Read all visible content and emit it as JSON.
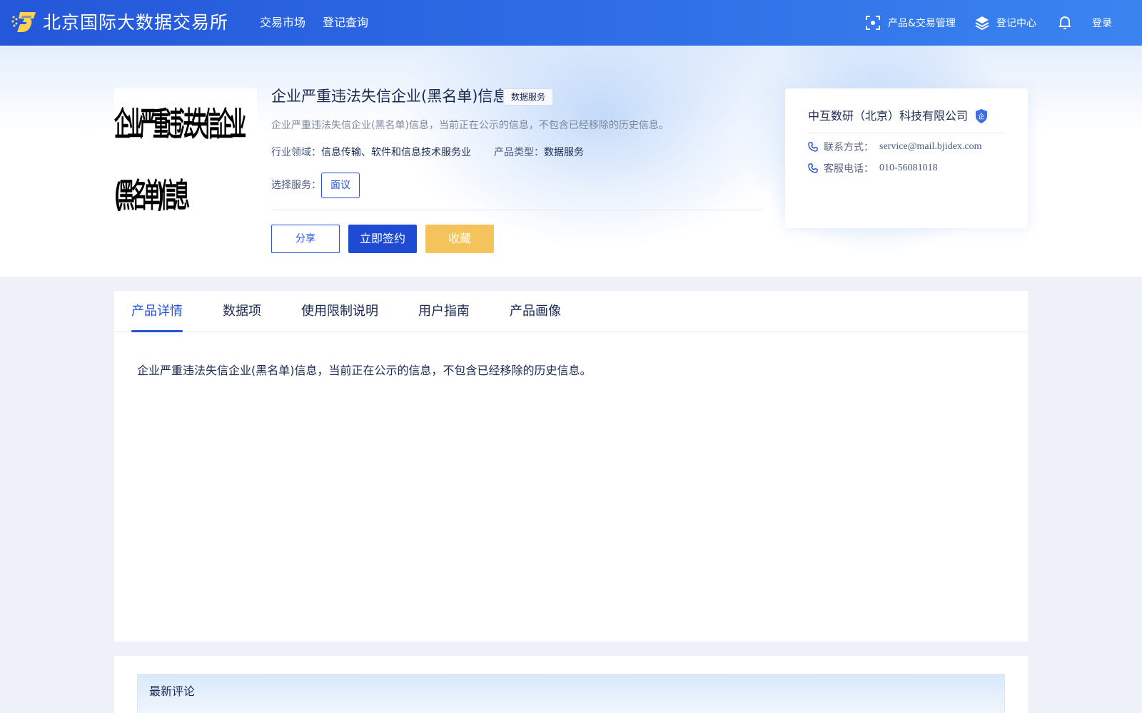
{
  "header": {
    "brand": "北京国际大数据交易所",
    "nav": [
      "交易市场",
      "登记查询"
    ],
    "product_mgmt": "产品&交易管理",
    "register_center": "登记中心",
    "login": "登录"
  },
  "product": {
    "thumbnail_text": "企业严重违法失信企业(黑名单)信息",
    "title": "企业严重违法失信企业(黑名单)信息",
    "tag": "数据服务",
    "description": "企业严重违法失信企业(黑名单)信息，当前正在公示的信息，不包含已经移除的历史信息。",
    "industry_label": "行业领域：",
    "industry_value": "信息传输、软件和信息技术服务业",
    "type_label": "产品类型：",
    "type_value": "数据服务",
    "service_label": "选择服务：",
    "service_option": "面议",
    "btn_share": "分享",
    "btn_sign": "立即签约",
    "btn_favorite": "收藏"
  },
  "company": {
    "name": "中互数研（北京）科技有限公司",
    "badge": "企",
    "contact_label": "联系方式：",
    "contact_value": "service@mail.bjidex.com",
    "phone_label": "客服电话：",
    "phone_value": "010-56081018"
  },
  "tabs": [
    "产品详情",
    "数据项",
    "使用限制说明",
    "用户指南",
    "产品画像"
  ],
  "active_tab": "产品详情",
  "detail_content": "企业严重违法失信企业(黑名单)信息，当前正在公示的信息，不包含已经移除的历史信息。",
  "comments": {
    "title": "最新评论"
  },
  "colors": {
    "primary": "#2453d6",
    "header_gradient_start": "#2457d9",
    "header_gradient_end": "#3a84f0",
    "favorite": "#f5c35c"
  }
}
